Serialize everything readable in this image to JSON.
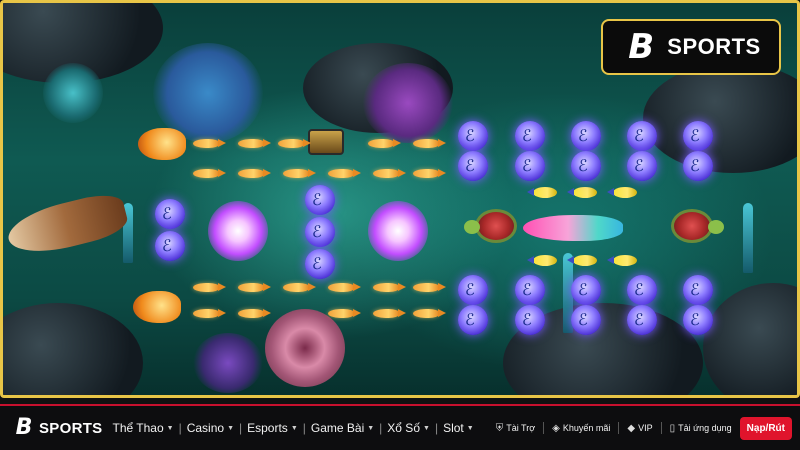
{
  "brand": {
    "name": "SPORTS",
    "mark": "B"
  },
  "nav": {
    "items": [
      {
        "label": "Thể Thao"
      },
      {
        "label": "Casino"
      },
      {
        "label": "Esports"
      },
      {
        "label": "Game Bài"
      },
      {
        "label": "Xổ Số"
      },
      {
        "label": "Slot"
      }
    ]
  },
  "right_links": {
    "sponsor": "Tài Trợ",
    "promo": "Khuyến mãi",
    "vip": "VIP",
    "app": "Tải ứng dụng"
  },
  "cta": {
    "label": "Nạp/Rút"
  },
  "icons": {
    "sponsor": "shield-icon",
    "promo": "tag-icon",
    "vip": "diamond-icon",
    "app": "phone-icon"
  },
  "colors": {
    "frame_border": "#e8c547",
    "accent": "#e0142c",
    "nav_bg": "#0d0d0f"
  }
}
